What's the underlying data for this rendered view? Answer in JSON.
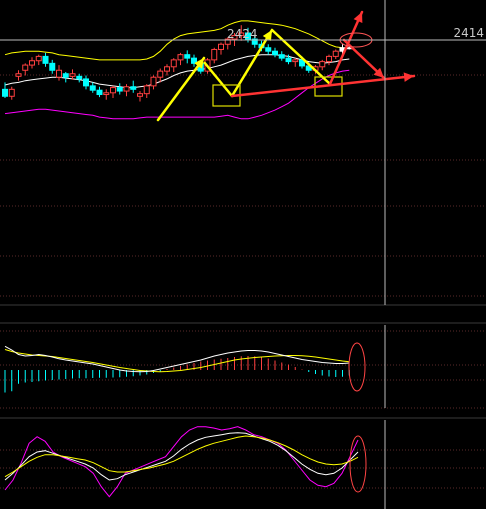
{
  "chart_data": [
    {
      "type": "candlestick",
      "panel": "main",
      "x": [
        1,
        2,
        3,
        4,
        5,
        6,
        7,
        8,
        9,
        10,
        11,
        12,
        13,
        14,
        15,
        16,
        17,
        18,
        19,
        20,
        21,
        22,
        23,
        24,
        25,
        26,
        27,
        28,
        29,
        30,
        31,
        32,
        33,
        34,
        35,
        36,
        37,
        38,
        39,
        40,
        41,
        42,
        43,
        44,
        45,
        46,
        47,
        48,
        49,
        50,
        51,
        52
      ],
      "ylim": [
        2280,
        2430
      ],
      "candles": [
        {
          "o": 2350,
          "h": 2358,
          "l": 2340,
          "c": 2342,
          "color": "#00ffff"
        },
        {
          "o": 2342,
          "h": 2353,
          "l": 2338,
          "c": 2350,
          "color": "#ff4040"
        },
        {
          "o": 2368,
          "h": 2372,
          "l": 2360,
          "c": 2365,
          "color": "#ff4040"
        },
        {
          "o": 2372,
          "h": 2380,
          "l": 2366,
          "c": 2378,
          "color": "#ff4040"
        },
        {
          "o": 2378,
          "h": 2387,
          "l": 2374,
          "c": 2383,
          "color": "#ff4040"
        },
        {
          "o": 2383,
          "h": 2390,
          "l": 2378,
          "c": 2388,
          "color": "#ff4040"
        },
        {
          "o": 2388,
          "h": 2392,
          "l": 2376,
          "c": 2380,
          "color": "#00ffff"
        },
        {
          "o": 2380,
          "h": 2384,
          "l": 2368,
          "c": 2372,
          "color": "#00ffff"
        },
        {
          "o": 2372,
          "h": 2378,
          "l": 2360,
          "c": 2364,
          "color": "#ff4040"
        },
        {
          "o": 2364,
          "h": 2370,
          "l": 2358,
          "c": 2368,
          "color": "#00ffff"
        },
        {
          "o": 2368,
          "h": 2373,
          "l": 2361,
          "c": 2365,
          "color": "#ff4040"
        },
        {
          "o": 2365,
          "h": 2368,
          "l": 2358,
          "c": 2362,
          "color": "#00ffff"
        },
        {
          "o": 2362,
          "h": 2366,
          "l": 2350,
          "c": 2354,
          "color": "#00ffff"
        },
        {
          "o": 2354,
          "h": 2358,
          "l": 2346,
          "c": 2349,
          "color": "#00ffff"
        },
        {
          "o": 2349,
          "h": 2353,
          "l": 2341,
          "c": 2344,
          "color": "#00ffff"
        },
        {
          "o": 2344,
          "h": 2350,
          "l": 2338,
          "c": 2346,
          "color": "#ff4040"
        },
        {
          "o": 2346,
          "h": 2354,
          "l": 2340,
          "c": 2352,
          "color": "#ff4040"
        },
        {
          "o": 2352,
          "h": 2357,
          "l": 2344,
          "c": 2348,
          "color": "#00ffff"
        },
        {
          "o": 2348,
          "h": 2356,
          "l": 2342,
          "c": 2353,
          "color": "#ff4040"
        },
        {
          "o": 2353,
          "h": 2360,
          "l": 2346,
          "c": 2350,
          "color": "#00ffff"
        },
        {
          "o": 2342,
          "h": 2348,
          "l": 2336,
          "c": 2345,
          "color": "#ff4040"
        },
        {
          "o": 2345,
          "h": 2356,
          "l": 2340,
          "c": 2354,
          "color": "#ff4040"
        },
        {
          "o": 2354,
          "h": 2366,
          "l": 2350,
          "c": 2364,
          "color": "#ff4040"
        },
        {
          "o": 2364,
          "h": 2374,
          "l": 2358,
          "c": 2371,
          "color": "#ff4040"
        },
        {
          "o": 2371,
          "h": 2379,
          "l": 2366,
          "c": 2376,
          "color": "#ff4040"
        },
        {
          "o": 2376,
          "h": 2386,
          "l": 2370,
          "c": 2384,
          "color": "#ff4040"
        },
        {
          "o": 2384,
          "h": 2392,
          "l": 2378,
          "c": 2390,
          "color": "#ff4040"
        },
        {
          "o": 2390,
          "h": 2395,
          "l": 2380,
          "c": 2386,
          "color": "#00ffff"
        },
        {
          "o": 2386,
          "h": 2390,
          "l": 2376,
          "c": 2380,
          "color": "#00ffff"
        },
        {
          "o": 2380,
          "h": 2384,
          "l": 2368,
          "c": 2371,
          "color": "#00ffff"
        },
        {
          "o": 2371,
          "h": 2386,
          "l": 2368,
          "c": 2384,
          "color": "#ff4040"
        },
        {
          "o": 2384,
          "h": 2398,
          "l": 2380,
          "c": 2396,
          "color": "#ff4040"
        },
        {
          "o": 2396,
          "h": 2404,
          "l": 2390,
          "c": 2402,
          "color": "#ff4040"
        },
        {
          "o": 2402,
          "h": 2410,
          "l": 2396,
          "c": 2408,
          "color": "#ff4040"
        },
        {
          "o": 2408,
          "h": 2415,
          "l": 2400,
          "c": 2412,
          "color": "#ff4040"
        },
        {
          "o": 2412,
          "h": 2424,
          "l": 2406,
          "c": 2415,
          "color": "#ff4040"
        },
        {
          "o": 2415,
          "h": 2421,
          "l": 2404,
          "c": 2408,
          "color": "#00ffff"
        },
        {
          "o": 2408,
          "h": 2412,
          "l": 2398,
          "c": 2402,
          "color": "#00ffff"
        },
        {
          "o": 2402,
          "h": 2406,
          "l": 2394,
          "c": 2398,
          "color": "#00ffff"
        },
        {
          "o": 2398,
          "h": 2402,
          "l": 2390,
          "c": 2394,
          "color": "#00ffff"
        },
        {
          "o": 2394,
          "h": 2398,
          "l": 2387,
          "c": 2390,
          "color": "#00ffff"
        },
        {
          "o": 2390,
          "h": 2394,
          "l": 2383,
          "c": 2386,
          "color": "#00ffff"
        },
        {
          "o": 2386,
          "h": 2390,
          "l": 2379,
          "c": 2382,
          "color": "#00ffff"
        },
        {
          "o": 2382,
          "h": 2386,
          "l": 2376,
          "c": 2384,
          "color": "#ff4040"
        },
        {
          "o": 2384,
          "h": 2388,
          "l": 2374,
          "c": 2377,
          "color": "#00ffff"
        },
        {
          "o": 2377,
          "h": 2381,
          "l": 2369,
          "c": 2372,
          "color": "#00ffff"
        },
        {
          "o": 2372,
          "h": 2378,
          "l": 2368,
          "c": 2376,
          "color": "#ff4040"
        },
        {
          "o": 2376,
          "h": 2384,
          "l": 2372,
          "c": 2382,
          "color": "#ff4040"
        },
        {
          "o": 2382,
          "h": 2390,
          "l": 2378,
          "c": 2388,
          "color": "#ff4040"
        },
        {
          "o": 2388,
          "h": 2396,
          "l": 2385,
          "c": 2394,
          "color": "#ff4040"
        },
        {
          "o": 2394,
          "h": 2402,
          "l": 2390,
          "c": 2398,
          "color": "#ffffff"
        },
        {
          "o": 2398,
          "h": 2400,
          "l": 2396,
          "c": 2398,
          "color": "#ffffff"
        }
      ],
      "series": [
        {
          "color": "#ffff00",
          "values": [
            2390,
            2392,
            2393,
            2394,
            2394,
            2394,
            2393,
            2392,
            2390,
            2389,
            2388,
            2387,
            2386,
            2385,
            2384,
            2384,
            2384,
            2384,
            2384,
            2384,
            2384,
            2385,
            2388,
            2394,
            2402,
            2408,
            2412,
            2414,
            2415,
            2416,
            2417,
            2418,
            2420,
            2424,
            2427,
            2429,
            2429,
            2428,
            2427,
            2426,
            2425,
            2424,
            2422,
            2420,
            2417,
            2414,
            2410,
            2406,
            2402,
            2399,
            2398,
            2397
          ]
        },
        {
          "color": "#ffffff",
          "values": [
            2355,
            2357,
            2358,
            2360,
            2361,
            2362,
            2363,
            2364,
            2364,
            2363,
            2362,
            2361,
            2360,
            2358,
            2356,
            2355,
            2354,
            2353,
            2352,
            2352,
            2353,
            2354,
            2356,
            2359,
            2362,
            2366,
            2369,
            2371,
            2372,
            2373,
            2374,
            2376,
            2378,
            2381,
            2384,
            2386,
            2388,
            2389,
            2390,
            2390,
            2390,
            2389,
            2388,
            2386,
            2384,
            2382,
            2381,
            2380,
            2381,
            2382,
            2384,
            2385
          ]
        },
        {
          "color": "#ff00ff",
          "values": [
            2322,
            2323,
            2324,
            2325,
            2326,
            2327,
            2327,
            2326,
            2325,
            2324,
            2323,
            2322,
            2321,
            2320,
            2318,
            2317,
            2316,
            2316,
            2316,
            2316,
            2317,
            2318,
            2318,
            2318,
            2318,
            2318,
            2318,
            2318,
            2318,
            2318,
            2318,
            2318,
            2319,
            2320,
            2318,
            2316,
            2316,
            2318,
            2320,
            2323,
            2326,
            2330,
            2334,
            2340,
            2346,
            2352,
            2357,
            2362,
            2366,
            2369,
            2371,
            2372
          ]
        }
      ],
      "price_labels": {
        "high": "2424",
        "right": "2414"
      },
      "reference_price": 2414
    },
    {
      "type": "macd",
      "panel": "middle",
      "ylim": [
        -1.2,
        1.2
      ],
      "histogram": [
        -0.9,
        -0.85,
        -0.55,
        -0.5,
        -0.48,
        -0.45,
        -0.42,
        -0.4,
        -0.38,
        -0.36,
        -0.34,
        -0.33,
        -0.33,
        -0.32,
        -0.31,
        -0.31,
        -0.3,
        -0.29,
        -0.27,
        -0.25,
        -0.22,
        -0.18,
        -0.12,
        -0.06,
        0.04,
        0.1,
        0.16,
        0.22,
        0.28,
        0.34,
        0.38,
        0.42,
        0.45,
        0.48,
        0.52,
        0.55,
        0.56,
        0.55,
        0.52,
        0.46,
        0.38,
        0.3,
        0.22,
        0.12,
        0.02,
        -0.08,
        -0.16,
        -0.22,
        -0.26,
        -0.28,
        -0.27,
        -0.22
      ],
      "series": [
        {
          "color": "#ffff00",
          "values": [
            0.82,
            0.74,
            0.68,
            0.64,
            0.6,
            0.58,
            0.56,
            0.54,
            0.5,
            0.46,
            0.42,
            0.38,
            0.34,
            0.3,
            0.25,
            0.2,
            0.15,
            0.1,
            0.06,
            0.02,
            -0.02,
            -0.04,
            -0.06,
            -0.07,
            -0.06,
            -0.04,
            -0.02,
            0.02,
            0.06,
            0.1,
            0.16,
            0.22,
            0.28,
            0.34,
            0.4,
            0.44,
            0.47,
            0.5,
            0.52,
            0.54,
            0.56,
            0.57,
            0.58,
            0.58,
            0.57,
            0.55,
            0.52,
            0.48,
            0.44,
            0.4,
            0.36,
            0.33
          ]
        },
        {
          "color": "#ffffff",
          "values": [
            0.95,
            0.8,
            0.62,
            0.56,
            0.58,
            0.62,
            0.58,
            0.52,
            0.45,
            0.4,
            0.36,
            0.32,
            0.28,
            0.24,
            0.18,
            0.12,
            0.06,
            0.0,
            -0.04,
            -0.06,
            -0.07,
            -0.06,
            -0.02,
            0.04,
            0.1,
            0.16,
            0.22,
            0.28,
            0.34,
            0.4,
            0.48,
            0.56,
            0.62,
            0.68,
            0.72,
            0.76,
            0.78,
            0.78,
            0.76,
            0.72,
            0.66,
            0.6,
            0.54,
            0.48,
            0.42,
            0.38,
            0.34,
            0.3,
            0.28,
            0.26,
            0.26,
            0.28
          ]
        }
      ]
    },
    {
      "type": "kdj",
      "panel": "bottom",
      "ylim": [
        -10,
        110
      ],
      "series": [
        {
          "color": "#ff00ff",
          "values": [
            5,
            20,
            45,
            75,
            85,
            78,
            62,
            55,
            50,
            45,
            40,
            30,
            10,
            -5,
            10,
            30,
            35,
            40,
            45,
            50,
            55,
            70,
            85,
            95,
            100,
            100,
            98,
            95,
            97,
            100,
            95,
            88,
            85,
            80,
            75,
            65,
            50,
            35,
            20,
            12,
            10,
            15,
            30,
            55,
            80
          ]
        },
        {
          "color": "#ffffff",
          "values": [
            20,
            30,
            42,
            55,
            62,
            64,
            60,
            56,
            52,
            48,
            44,
            38,
            28,
            20,
            22,
            28,
            32,
            36,
            40,
            44,
            48,
            56,
            66,
            74,
            80,
            84,
            86,
            88,
            90,
            91,
            90,
            86,
            82,
            78,
            72,
            64,
            54,
            44,
            36,
            30,
            28,
            30,
            38,
            50,
            62
          ]
        },
        {
          "color": "#ffff00",
          "values": [
            25,
            32,
            40,
            48,
            54,
            58,
            58,
            56,
            54,
            52,
            50,
            46,
            40,
            34,
            32,
            32,
            34,
            36,
            38,
            41,
            44,
            48,
            54,
            60,
            66,
            71,
            75,
            78,
            81,
            84,
            86,
            85,
            83,
            80,
            76,
            71,
            65,
            58,
            52,
            47,
            44,
            43,
            44,
            48,
            54
          ]
        }
      ]
    }
  ],
  "colors": {
    "background": "#000000",
    "bullish": "#ff4040",
    "bearish": "#00ffff",
    "annotation_trend": "#ffff00",
    "annotation_signal": "#ff3333",
    "gridline": "#5a2a2a",
    "crosshair": "#bbbbbb"
  }
}
